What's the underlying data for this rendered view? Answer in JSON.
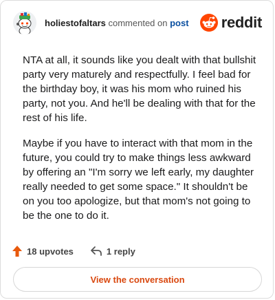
{
  "header": {
    "username": "holiestofaltars",
    "commented_on_text": "commented on",
    "post_link": "post",
    "brand_name": "reddit"
  },
  "comment": {
    "paragraphs": [
      "NTA at all, it sounds like you dealt with that bullshit party very maturely and respectfully. I feel bad for the birthday boy, it was his mom who ruined his party, not you. And he'll be dealing with that for the rest of his life.",
      "Maybe if you have to interact with that mom in the future, you could try to make things less awkward by offering an \"I'm sorry we left early, my daughter really needed to get some space.\" It shouldn't be on you too apologize, but that mom's not going to be the one to do it."
    ]
  },
  "actions": {
    "upvotes_label": "18 upvotes",
    "replies_label": "1 reply"
  },
  "cta": {
    "label": "View the conversation"
  },
  "colors": {
    "brand_orange": "#ff4500",
    "upvote_orange": "#e8590c",
    "cta_text": "#d9480f",
    "link_blue": "#0a4fa0"
  },
  "icons": {
    "avatar": "snoo-avatar-icon",
    "brand": "reddit-snoo-icon",
    "upvote": "upvote-arrow-icon",
    "reply": "reply-arrow-icon"
  }
}
